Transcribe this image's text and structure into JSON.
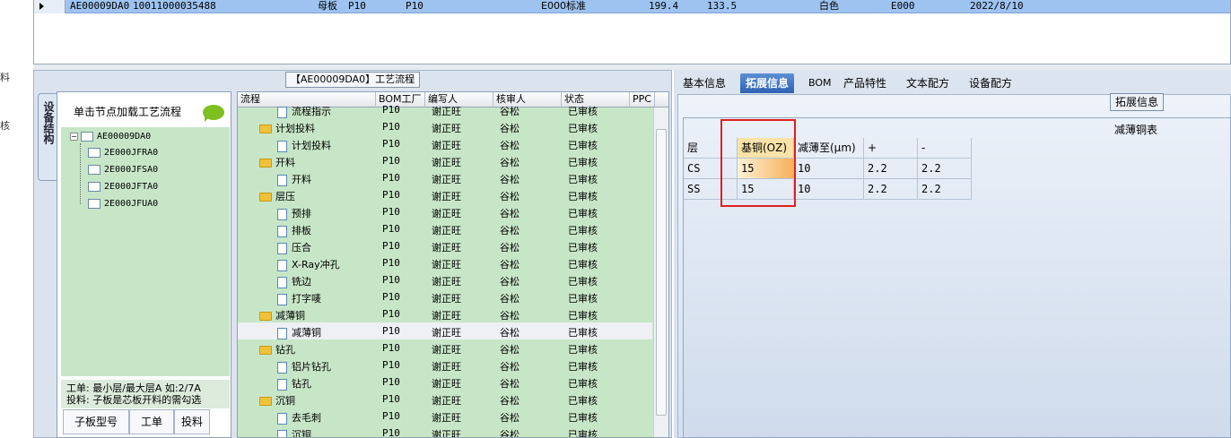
{
  "top_grid": {
    "row": {
      "code": "AE00009DA0",
      "number": "10011000035488",
      "type": "母板",
      "f1": "P10",
      "f2": "P10",
      "standard": "E000标准",
      "v1": "199.4",
      "v2": "133.5",
      "color": "白色",
      "code2": "E000",
      "date": "2022/8/10"
    }
  },
  "edge_labels": [
    "料",
    "核"
  ],
  "process_panel": {
    "title": "【AE00009DA0】工艺流程",
    "left_tab": "设备结构",
    "hint": "单击节点加载工艺流程",
    "tree": {
      "root": "AE00009DA0",
      "children": [
        "2E000JFRA0",
        "2E000JFSA0",
        "2E000JFTA0",
        "2E000JFUA0"
      ]
    },
    "note_line1": "工单: 最小层/最大层A 如:2/7A",
    "note_line2": "投料: 子板是芯板开料的需勾选",
    "bottom_tabs": [
      "子板型号",
      "工单",
      "投料"
    ],
    "grid": {
      "headers": [
        "流程",
        "BOM工厂",
        "编写人",
        "核审人",
        "状态",
        "PPC"
      ],
      "rows": [
        {
          "name": "流程指示",
          "kind": "doc",
          "bom": "P10",
          "writer": "谢正旺",
          "reviewer": "谷松",
          "status": "已审核"
        },
        {
          "name": "计划投料",
          "kind": "folder",
          "bom": "P10",
          "writer": "谢正旺",
          "reviewer": "谷松",
          "status": "已审核"
        },
        {
          "name": "计划投料",
          "kind": "doc",
          "bom": "P10",
          "writer": "谢正旺",
          "reviewer": "谷松",
          "status": "已审核"
        },
        {
          "name": "开料",
          "kind": "folder",
          "bom": "P10",
          "writer": "谢正旺",
          "reviewer": "谷松",
          "status": "已审核"
        },
        {
          "name": "开料",
          "kind": "doc",
          "bom": "P10",
          "writer": "谢正旺",
          "reviewer": "谷松",
          "status": "已审核"
        },
        {
          "name": "层压",
          "kind": "folder",
          "bom": "P10",
          "writer": "谢正旺",
          "reviewer": "谷松",
          "status": "已审核"
        },
        {
          "name": "预排",
          "kind": "doc",
          "bom": "P10",
          "writer": "谢正旺",
          "reviewer": "谷松",
          "status": "已审核"
        },
        {
          "name": "排板",
          "kind": "doc",
          "bom": "P10",
          "writer": "谢正旺",
          "reviewer": "谷松",
          "status": "已审核"
        },
        {
          "name": "压合",
          "kind": "doc",
          "bom": "P10",
          "writer": "谢正旺",
          "reviewer": "谷松",
          "status": "已审核"
        },
        {
          "name": "X-Ray冲孔",
          "kind": "doc",
          "bom": "P10",
          "writer": "谢正旺",
          "reviewer": "谷松",
          "status": "已审核"
        },
        {
          "name": "铣边",
          "kind": "doc",
          "bom": "P10",
          "writer": "谢正旺",
          "reviewer": "谷松",
          "status": "已审核"
        },
        {
          "name": "打字唛",
          "kind": "doc",
          "bom": "P10",
          "writer": "谢正旺",
          "reviewer": "谷松",
          "status": "已审核"
        },
        {
          "name": "减薄铜",
          "kind": "folder",
          "bom": "P10",
          "writer": "谢正旺",
          "reviewer": "谷松",
          "status": "已审核"
        },
        {
          "name": "减薄铜",
          "kind": "doc",
          "bom": "P10",
          "writer": "谢正旺",
          "reviewer": "谷松",
          "status": "已审核",
          "selected": true
        },
        {
          "name": "钻孔",
          "kind": "folder",
          "bom": "P10",
          "writer": "谢正旺",
          "reviewer": "谷松",
          "status": "已审核"
        },
        {
          "name": "铝片钻孔",
          "kind": "doc",
          "bom": "P10",
          "writer": "谢正旺",
          "reviewer": "谷松",
          "status": "已审核"
        },
        {
          "name": "钻孔",
          "kind": "doc",
          "bom": "P10",
          "writer": "谢正旺",
          "reviewer": "谷松",
          "status": "已审核"
        },
        {
          "name": "沉铜",
          "kind": "folder",
          "bom": "P10",
          "writer": "谢正旺",
          "reviewer": "谷松",
          "status": "已审核"
        },
        {
          "name": "去毛刺",
          "kind": "doc",
          "bom": "P10",
          "writer": "谢正旺",
          "reviewer": "谷松",
          "status": "已审核"
        },
        {
          "name": "沉铜",
          "kind": "doc",
          "bom": "P10",
          "writer": "谢正旺",
          "reviewer": "谷松",
          "status": "已审核"
        }
      ]
    }
  },
  "right_panel": {
    "tabs": [
      "基本信息",
      "拓展信息",
      "BOM",
      "产品特性",
      "文本配方",
      "设备配方"
    ],
    "active_tab": 1,
    "group_label": "拓展信息",
    "table_title": "减薄铜表",
    "headers": [
      "层",
      "基铜(OZ)",
      "减薄至(μm)",
      "+",
      "-"
    ],
    "rows": [
      [
        "CS",
        "15",
        "10",
        "2.2",
        "2.2"
      ],
      [
        "SS",
        "15",
        "10",
        "2.2",
        "2.2"
      ]
    ]
  }
}
